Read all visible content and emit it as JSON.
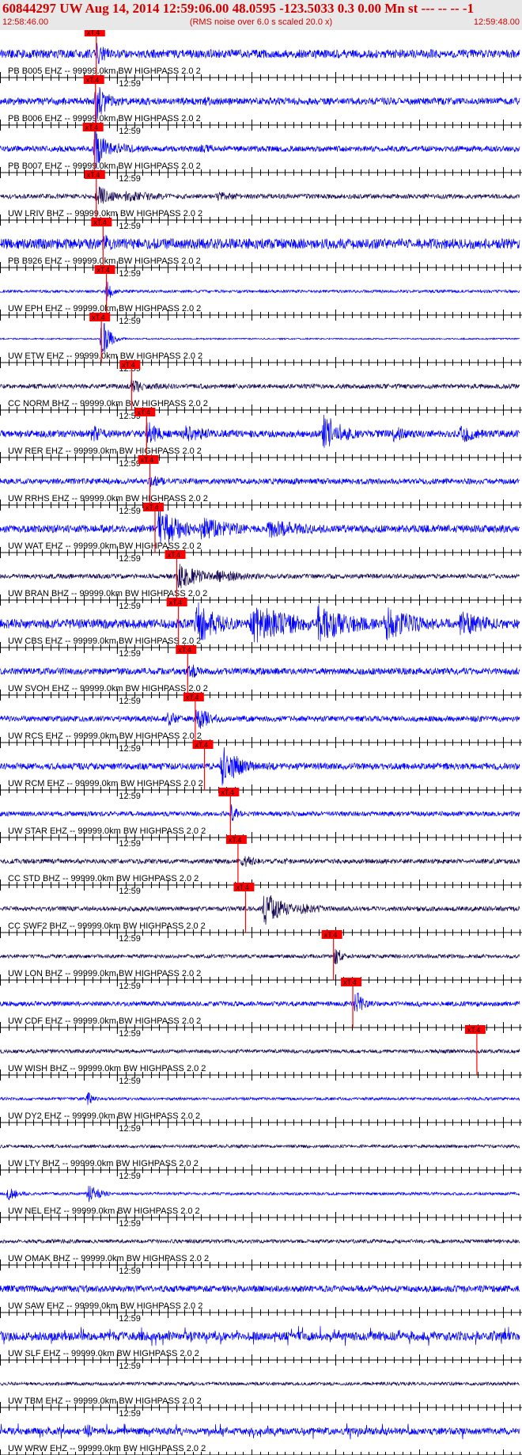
{
  "header": {
    "title": "60844297 UW Aug 14, 2014 12:59:06.00   48.0595 -123.5033  0.3 0.00 Mn st --- -- --   -1",
    "start_time": "12:58:46.00",
    "end_time": "12:59:48.00",
    "rms_note": "(RMS noise over 6.0 s scaled 20.0 x)"
  },
  "chart_data": {
    "type": "line",
    "title": "60844297 UW Aug 14, 2014 12:59:06.00   48.0595 -123.5033  0.3 0.00 Mn st --- -- --   -1",
    "xlim": [
      "12:58:46.00",
      "12:59:48.00"
    ],
    "minute_marker": "12:59",
    "pick_label": "xT.4",
    "colors": {
      "blue": "#0000ff",
      "navy": "#1a0a55",
      "pick": "#ff0000",
      "background": "#ffffff",
      "header": "#e8e8e8"
    },
    "series": [
      {
        "label": "PB B005 EHZ -- 99999.0km BW  HIGHPASS  2.0  2",
        "color": "blue",
        "pick_s": 11.4,
        "amp": 0.18,
        "events": [
          [
            11.6,
            0.5,
            1.7
          ],
          [
            12.5,
            0.25,
            2.4
          ],
          [
            25,
            0.14,
            3
          ]
        ]
      },
      {
        "label": "PB B006 EHZ -- 99999.0km BW  HIGHPASS  2.0  2",
        "color": "blue",
        "pick_s": 11.3,
        "amp": 0.15,
        "events": [
          [
            11.5,
            0.95,
            1.3
          ],
          [
            13,
            0.3,
            3
          ],
          [
            24.5,
            0.2,
            3
          ]
        ]
      },
      {
        "label": "PB B007 EHZ -- 99999.0km BW  HIGHPASS  2.0  2",
        "color": "blue",
        "pick_s": 11.2,
        "amp": 0.12,
        "events": [
          [
            11.4,
            0.95,
            1.4
          ],
          [
            14,
            0.3,
            3.5
          ],
          [
            24,
            0.25,
            3
          ]
        ]
      },
      {
        "label": "UW LRIV BHZ -- 99999.0km BW  HIGHPASS  2.0  2",
        "color": "navy",
        "pick_s": 11.4,
        "amp": 0.1,
        "events": [
          [
            11.6,
            0.5,
            2
          ],
          [
            15,
            0.25,
            6
          ],
          [
            26,
            0.2,
            5
          ]
        ]
      },
      {
        "label": "PB B926 EHZ -- 99999.0km BW  HIGHPASS  2.0  2",
        "color": "blue",
        "pick_s": 12.2,
        "amp": 0.22,
        "events": [
          [
            12.4,
            0.45,
            1.5
          ]
        ]
      },
      {
        "label": "UW EPH EHZ -- 99999.0km BW  HIGHPASS  2.0  2",
        "color": "blue",
        "pick_s": 12.6,
        "amp": 0.06,
        "events": [
          [
            12.8,
            0.45,
            0.8
          ]
        ]
      },
      {
        "label": "UW ETW EHZ -- 99999.0km BW  HIGHPASS  2.0  2",
        "color": "blue",
        "pick_s": 12.0,
        "amp": 0.03,
        "events": [
          [
            12.2,
            0.95,
            0.9
          ]
        ]
      },
      {
        "label": "CC NORM BHZ -- 99999.0km BW  HIGHPASS  2.0  2",
        "color": "navy",
        "pick_s": 15.6,
        "amp": 0.1,
        "events": [
          [
            15.8,
            0.4,
            1.5
          ],
          [
            18,
            0.15,
            8
          ]
        ]
      },
      {
        "label": "UW RER EHZ -- 99999.0km BW  HIGHPASS  2.0  2",
        "color": "blue",
        "pick_s": 17.4,
        "amp": 0.15,
        "events": [
          [
            11,
            0.4,
            2
          ],
          [
            17.6,
            0.55,
            2
          ],
          [
            22,
            0.4,
            4
          ],
          [
            38.7,
            0.9,
            2.5
          ],
          [
            47,
            0.35,
            3
          ],
          [
            55,
            0.4,
            3
          ]
        ]
      },
      {
        "label": "UW RRHS EHZ -- 99999.0km BW  HIGHPASS  2.0  2",
        "color": "blue",
        "pick_s": 17.8,
        "amp": 0.12,
        "events": [
          [
            18,
            0.25,
            3
          ],
          [
            35,
            0.15,
            4
          ]
        ]
      },
      {
        "label": "UW WAT EHZ -- 99999.0km BW  HIGHPASS  2.0  2",
        "color": "blue",
        "pick_s": 18.4,
        "amp": 0.16,
        "events": [
          [
            19,
            0.95,
            3
          ],
          [
            24,
            0.5,
            6
          ],
          [
            32,
            0.4,
            8
          ],
          [
            44,
            0.2,
            6
          ]
        ]
      },
      {
        "label": "UW BRAN BHZ -- 99999.0km BW  HIGHPASS  2.0  2",
        "color": "navy",
        "pick_s": 21.0,
        "amp": 0.1,
        "events": [
          [
            21.3,
            0.6,
            3
          ],
          [
            26,
            0.3,
            5
          ]
        ]
      },
      {
        "label": "UW CBS EHZ -- 99999.0km BW  HIGHPASS  2.0  2",
        "color": "blue",
        "pick_s": 21.2,
        "amp": 0.2,
        "events": [
          [
            23.5,
            1,
            3
          ],
          [
            30,
            0.9,
            6
          ],
          [
            38,
            0.85,
            5
          ],
          [
            46,
            0.75,
            5
          ],
          [
            55,
            0.55,
            5
          ]
        ]
      },
      {
        "label": "UW SVOH EHZ -- 99999.0km BW  HIGHPASS  2.0  2",
        "color": "blue",
        "pick_s": 22.3,
        "amp": 0.14,
        "events": [
          [
            22.6,
            0.45,
            1.5
          ]
        ]
      },
      {
        "label": "UW RCS EHZ -- 99999.0km BW  HIGHPASS  2.0  2",
        "color": "blue",
        "pick_s": 23.2,
        "amp": 0.12,
        "events": [
          [
            20,
            0.4,
            1.5
          ],
          [
            23.5,
            0.55,
            2
          ]
        ]
      },
      {
        "label": "UW RCM EHZ -- 99999.0km BW  HIGHPASS  2.0  2",
        "color": "blue",
        "pick_s": 24.3,
        "amp": 0.14,
        "events": [
          [
            26.5,
            0.9,
            2.5
          ],
          [
            32,
            0.2,
            3
          ]
        ]
      },
      {
        "label": "UW STAR EHZ -- 99999.0km BW  HIGHPASS  2.0  2",
        "color": "blue",
        "pick_s": 27.4,
        "amp": 0.1,
        "events": [
          [
            27.6,
            0.4,
            1
          ]
        ]
      },
      {
        "label": "CC STD BHZ -- 99999.0km BW  HIGHPASS  2.0  2",
        "color": "navy",
        "pick_s": 28.3,
        "amp": 0.1,
        "events": [
          [
            29,
            0.3,
            2
          ],
          [
            34,
            0.15,
            4
          ]
        ]
      },
      {
        "label": "CC SWF2 BHZ -- 99999.0km BW  HIGHPASS  2.0  2",
        "color": "navy",
        "pick_s": 29.2,
        "amp": 0.1,
        "events": [
          [
            31.5,
            0.8,
            2.5
          ],
          [
            36,
            0.25,
            4
          ]
        ]
      },
      {
        "label": "UW LON BHZ -- 99999.0km BW  HIGHPASS  2.0  2",
        "color": "navy",
        "pick_s": 39.7,
        "amp": 0.08,
        "events": [
          [
            40,
            0.45,
            1
          ]
        ]
      },
      {
        "label": "UW CDF EHZ -- 99999.0km BW  HIGHPASS  2.0  2",
        "color": "blue",
        "pick_s": 42.0,
        "amp": 0.1,
        "events": [
          [
            42.5,
            0.6,
            1
          ],
          [
            50,
            0.2,
            1
          ],
          [
            57,
            0.15,
            1
          ]
        ]
      },
      {
        "label": "UW WISH BHZ -- 99999.0km BW  HIGHPASS  2.0  2",
        "color": "navy",
        "pick_s": 56.8,
        "amp": 0.08,
        "events": []
      },
      {
        "label": "UW DY2 EHZ -- 99999.0km BW  HIGHPASS  2.0  2",
        "color": "blue",
        "pick_s": null,
        "amp": 0.06,
        "events": [
          [
            10.5,
            0.3,
            0.8
          ]
        ]
      },
      {
        "label": "UW LTY BHZ -- 99999.0km BW  HIGHPASS  2.0  2",
        "color": "navy",
        "pick_s": null,
        "amp": 0.07,
        "events": []
      },
      {
        "label": "UW NEL EHZ -- 99999.0km BW  HIGHPASS  2.0  2",
        "color": "blue",
        "pick_s": null,
        "amp": 0.06,
        "events": [
          [
            1,
            0.3,
            1.5
          ],
          [
            10.5,
            0.45,
            1.5
          ]
        ]
      },
      {
        "label": "UW OMAK BHZ -- 99999.0km BW  HIGHPASS  2.0  2",
        "color": "navy",
        "pick_s": null,
        "amp": 0.08,
        "events": []
      },
      {
        "label": "UW SAW EHZ -- 99999.0km BW  HIGHPASS  2.0  2",
        "color": "blue",
        "pick_s": null,
        "amp": 0.14,
        "events": []
      },
      {
        "label": "UW SLF EHZ -- 99999.0km BW  HIGHPASS  2.0  2",
        "color": "blue",
        "pick_s": null,
        "amp": 0.18,
        "spiky": true,
        "events": []
      },
      {
        "label": "UW TBM EHZ -- 99999.0km BW  HIGHPASS  2.0  2",
        "color": "navy",
        "pick_s": null,
        "amp": 0.07,
        "events": []
      },
      {
        "label": "UW WRW EHZ -- 99999.0km BW  HIGHPASS  2.0  2",
        "color": "blue",
        "pick_s": null,
        "amp": 0.14,
        "spiky": true,
        "events": [
          [
            10.5,
            0.3,
            1
          ]
        ]
      }
    ]
  }
}
